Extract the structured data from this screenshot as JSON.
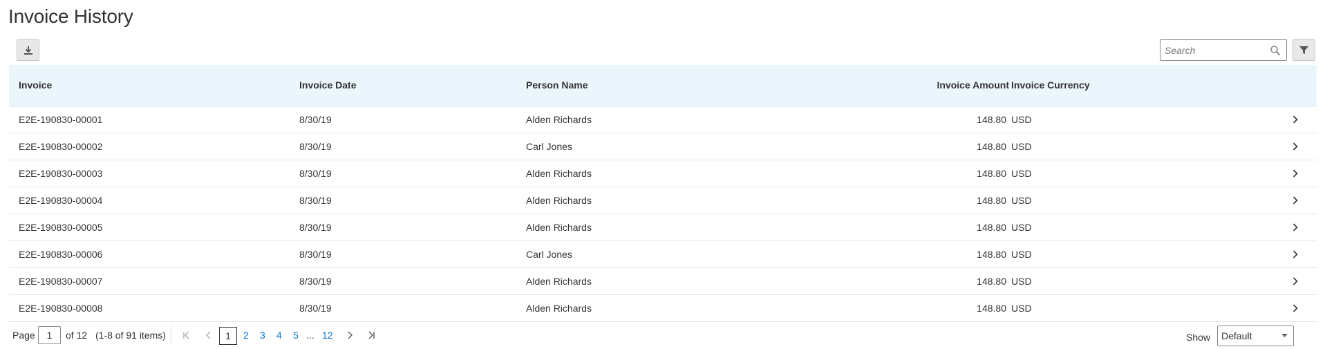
{
  "page": {
    "title": "Invoice History"
  },
  "toolbar": {
    "search_placeholder": "Search"
  },
  "table": {
    "headers": {
      "invoice": "Invoice",
      "invoice_date": "Invoice Date",
      "person_name": "Person Name",
      "invoice_amount": "Invoice Amount",
      "invoice_currency": "Invoice Currency"
    },
    "rows": [
      {
        "invoice": "E2E-190830-00001",
        "date": "8/30/19",
        "person": "Alden Richards",
        "amount": "148.80",
        "currency": "USD"
      },
      {
        "invoice": "E2E-190830-00002",
        "date": "8/30/19",
        "person": "Carl Jones",
        "amount": "148.80",
        "currency": "USD"
      },
      {
        "invoice": "E2E-190830-00003",
        "date": "8/30/19",
        "person": "Alden Richards",
        "amount": "148.80",
        "currency": "USD"
      },
      {
        "invoice": "E2E-190830-00004",
        "date": "8/30/19",
        "person": "Alden Richards",
        "amount": "148.80",
        "currency": "USD"
      },
      {
        "invoice": "E2E-190830-00005",
        "date": "8/30/19",
        "person": "Alden Richards",
        "amount": "148.80",
        "currency": "USD"
      },
      {
        "invoice": "E2E-190830-00006",
        "date": "8/30/19",
        "person": "Carl Jones",
        "amount": "148.80",
        "currency": "USD"
      },
      {
        "invoice": "E2E-190830-00007",
        "date": "8/30/19",
        "person": "Alden Richards",
        "amount": "148.80",
        "currency": "USD"
      },
      {
        "invoice": "E2E-190830-00008",
        "date": "8/30/19",
        "person": "Alden Richards",
        "amount": "148.80",
        "currency": "USD"
      }
    ]
  },
  "pagination": {
    "page_label": "Page",
    "current_page": "1",
    "of_label": "of 12",
    "items_info": "(1-8 of 91 items)",
    "pages": [
      "1",
      "2",
      "3",
      "4",
      "5"
    ],
    "ellipsis": "...",
    "last_page": "12",
    "show_label": "Show",
    "show_value": "Default"
  },
  "icons": {
    "download": "download-icon",
    "search": "search-icon",
    "filter": "filter-icon",
    "row_action": "chevron-right-icon",
    "first": "first-page-icon",
    "prev": "previous-page-icon",
    "next": "next-page-icon",
    "last": "last-page-icon",
    "dropdown": "chevron-down-icon"
  },
  "colors": {
    "header_bg": "#eaf5fc",
    "link": "#0572ce"
  }
}
